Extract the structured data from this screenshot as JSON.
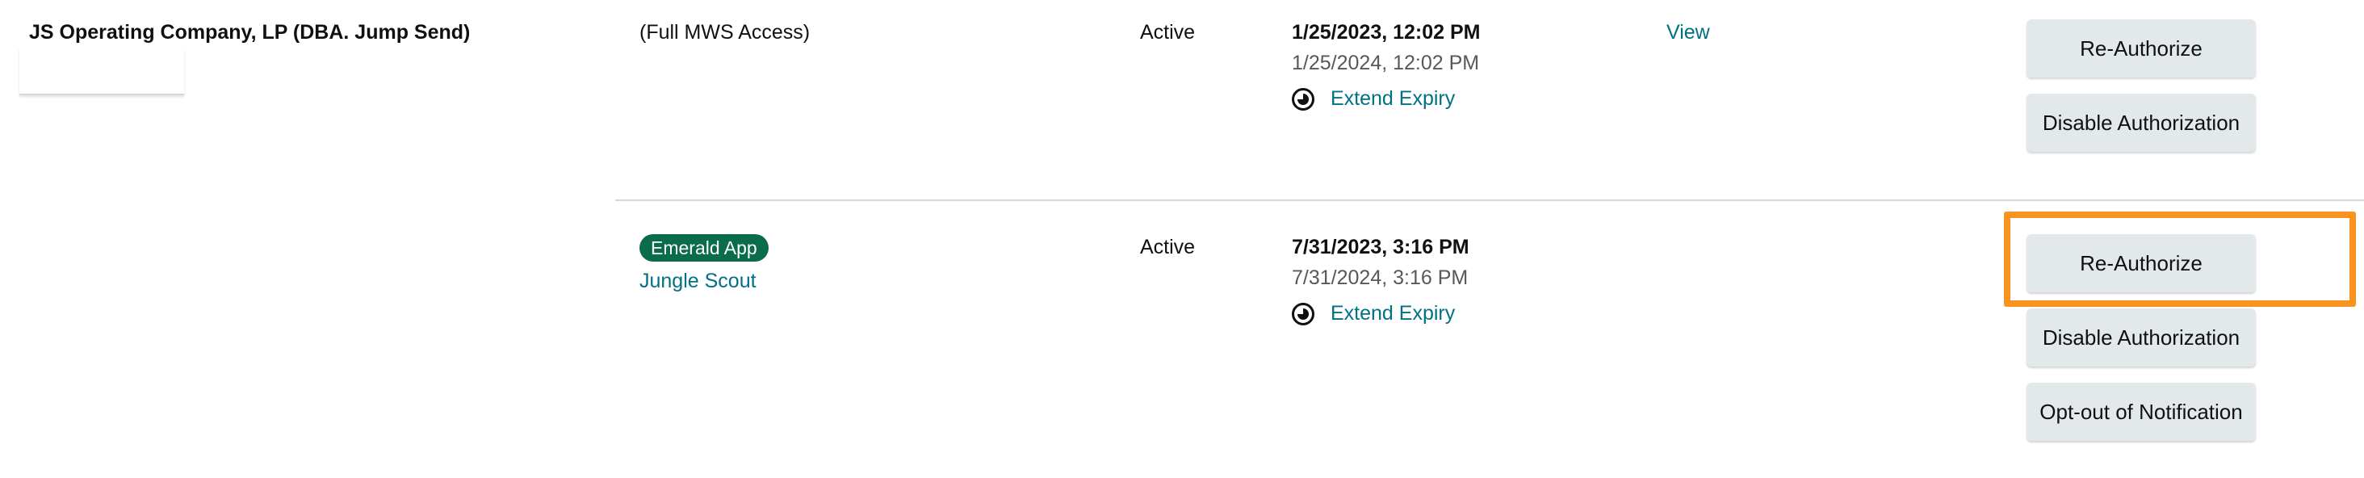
{
  "company": {
    "name": "JS Operating Company, LP (DBA. Jump Send)"
  },
  "rows": [
    {
      "app_access": "(Full MWS Access)",
      "status": "Active",
      "authorized_date": "1/25/2023, 12:02 PM",
      "expiry_date": "1/25/2024, 12:02 PM",
      "extend_label": "Extend Expiry",
      "view_label": "View",
      "buttons": {
        "reauthorize": "Re-Authorize",
        "disable": "Disable Authorization"
      }
    },
    {
      "badge": "Emerald App",
      "app_name": "Jungle Scout",
      "status": "Active",
      "authorized_date": "7/31/2023, 3:16 PM",
      "expiry_date": "7/31/2024, 3:16 PM",
      "extend_label": "Extend Expiry",
      "buttons": {
        "reauthorize": "Re-Authorize",
        "disable": "Disable Authorization",
        "optout": "Opt-out of Notification"
      }
    }
  ],
  "colors": {
    "link": "#007185",
    "badge_bg": "#0b6b4d",
    "button_bg": "#e3e9ea",
    "highlight": "#f7931e"
  },
  "icons": {
    "extend": "clock-icon"
  }
}
